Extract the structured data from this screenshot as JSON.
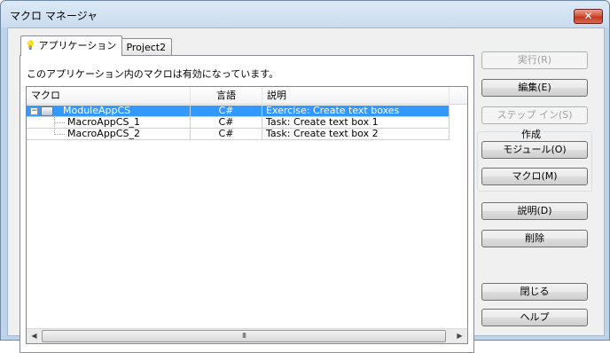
{
  "window": {
    "title": "マクロ マネージャ",
    "close_glyph": "✕"
  },
  "tabs": [
    {
      "label": "アプリケーション",
      "icon": "lightbulb-icon"
    },
    {
      "label": "Project2",
      "icon": "lightbulb-icon"
    }
  ],
  "panel": {
    "info_text": "このアプリケーション内のマクロは有効になっています。"
  },
  "list": {
    "columns": [
      "マクロ",
      "言語",
      "説明"
    ],
    "rows": [
      {
        "name": "ModuleAppCS",
        "language": "C#",
        "description": "Exercise: Create text boxes",
        "selected": true,
        "level": 0,
        "expander": "−"
      },
      {
        "name": "MacroAppCS_1",
        "language": "C#",
        "description": "Task: Create text box 1",
        "selected": false,
        "level": 1
      },
      {
        "name": "MacroAppCS_2",
        "language": "C#",
        "description": "Task: Create text box 2",
        "selected": false,
        "level": 1
      }
    ],
    "scrollbar": {
      "left_arrow": "◀",
      "right_arrow": "▶",
      "thumb_grip": "III"
    }
  },
  "buttons": {
    "run": "実行(R)",
    "edit": "編集(E)",
    "step_in": "ステップ イン(S)",
    "create_group_label": "作成",
    "module": "モジュール(O)",
    "macro": "マクロ(M)",
    "description": "説明(D)",
    "delete": "削除",
    "close": "閉じる",
    "help": "ヘルプ"
  },
  "colors": {
    "selection": "#3399ff",
    "close_button": "#c23a20"
  }
}
